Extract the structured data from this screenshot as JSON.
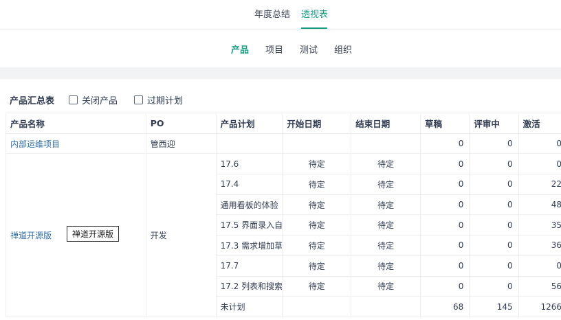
{
  "top_tabs": [
    {
      "label": "年度总结",
      "active": false
    },
    {
      "label": "透视表",
      "active": true
    }
  ],
  "sub_tabs": [
    {
      "label": "产品",
      "active": true
    },
    {
      "label": "项目",
      "active": false
    },
    {
      "label": "测试",
      "active": false
    },
    {
      "label": "组织",
      "active": false
    }
  ],
  "filters": {
    "title": "产品汇总表",
    "closed_products_label": "关闭产品",
    "expired_plans_label": "过期计划"
  },
  "table": {
    "headers": [
      "产品名称",
      "PO",
      "产品计划",
      "开始日期",
      "结束日期",
      "草稿",
      "评审中",
      "激活"
    ],
    "products": [
      {
        "name": "内部运维项目",
        "po": "管西迎",
        "plans": [
          {
            "plan": "",
            "start": "",
            "end": "",
            "draft": "0",
            "review": "0",
            "active": "0"
          }
        ]
      },
      {
        "name": "禅道开源版",
        "po": "开发",
        "plans": [
          {
            "plan": "17.6",
            "start": "待定",
            "end": "待定",
            "draft": "0",
            "review": "0",
            "active": "0"
          },
          {
            "plan": "17.4",
            "start": "待定",
            "end": "待定",
            "draft": "0",
            "review": "0",
            "active": "22"
          },
          {
            "plan": "通用看板的体验",
            "start": "待定",
            "end": "待定",
            "draft": "0",
            "review": "0",
            "active": "48"
          },
          {
            "plan": "17.5 界面录入自",
            "start": "待定",
            "end": "待定",
            "draft": "0",
            "review": "0",
            "active": "35"
          },
          {
            "plan": "17.3 需求增加草",
            "start": "待定",
            "end": "待定",
            "draft": "0",
            "review": "0",
            "active": "36"
          },
          {
            "plan": "17.7",
            "start": "待定",
            "end": "待定",
            "draft": "0",
            "review": "0",
            "active": "0"
          },
          {
            "plan": "17.2 列表和搜索",
            "start": "待定",
            "end": "待定",
            "draft": "0",
            "review": "0",
            "active": "56"
          },
          {
            "plan": "未计划",
            "start": "",
            "end": "",
            "draft": "68",
            "review": "145",
            "active": "1266"
          }
        ]
      }
    ]
  },
  "tooltip": "禅道开源版"
}
